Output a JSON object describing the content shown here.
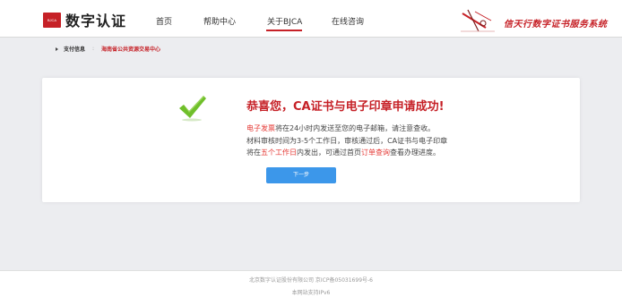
{
  "header": {
    "logo_badge": "BJCA",
    "logo_text": "数字认证",
    "nav": [
      {
        "label": "首页"
      },
      {
        "label": "帮助中心"
      },
      {
        "label": "关于BJCA"
      },
      {
        "label": "在线咨询"
      }
    ],
    "active_nav": "关于BJCA",
    "slogan": "信天行数字证书服务系统"
  },
  "breadcrumb": {
    "label": "支付信息",
    "separator": ":",
    "link": "海南省公共资源交易中心"
  },
  "result": {
    "title": "恭喜您，CA证书与电子印章申请成功!",
    "line1_highlight": "电子发票",
    "line1_rest": "将在24小时内发送至您的电子邮箱，请注意查收。",
    "line2": "材料审核时间为3-5个工作日，审核通过后，CA证书与电子印章",
    "line3_a": "将在",
    "line3_highlight1": "五个工作日",
    "line3_b": "内发出，可通过首页",
    "line3_highlight2": "订单查询",
    "line3_c": "查看办理进度。",
    "next_button": "下一步"
  },
  "footer": {
    "line1": "北京数字认证股份有限公司 京ICP备05031699号-6",
    "line2": "本网站支持IPv6"
  },
  "colors": {
    "brand_red": "#c62127",
    "highlight_red": "#e53935",
    "button_blue": "#3c97ea",
    "check_green": "#6fbf2a"
  }
}
